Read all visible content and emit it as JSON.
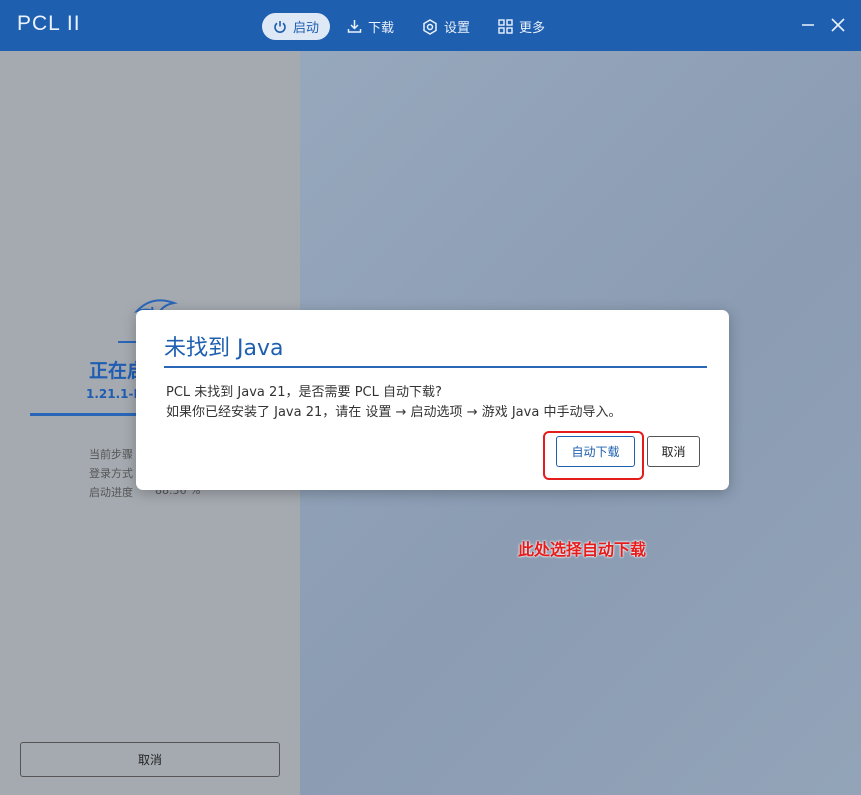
{
  "app": {
    "title": "PCL II"
  },
  "nav": [
    {
      "label": "启动",
      "icon": "power-icon",
      "active": true
    },
    {
      "label": "下载",
      "icon": "download-icon",
      "active": false
    },
    {
      "label": "设置",
      "icon": "gear-icon",
      "active": false
    },
    {
      "label": "更多",
      "icon": "grid-icon",
      "active": false
    }
  ],
  "left_panel": {
    "title": "正在启",
    "version": "1.21.1-F",
    "info": [
      "当前步骤",
      "登录方式",
      "启动进度"
    ],
    "progress_value": "88.36 %",
    "cancel_label": "取消"
  },
  "dialog": {
    "title": "未找到 Java",
    "message_line1": "PCL 未找到 Java 21，是否需要 PCL 自动下载?",
    "message_line2": "如果你已经安装了 Java 21，请在 设置 → 启动选项 → 游戏 Java 中手动导入。",
    "confirm_label": "自动下载",
    "cancel_label": "取消"
  },
  "annotation": {
    "text": "此处选择自动下载",
    "color": "#e51c1c"
  },
  "colors": {
    "accent": "#1e5fb0"
  }
}
